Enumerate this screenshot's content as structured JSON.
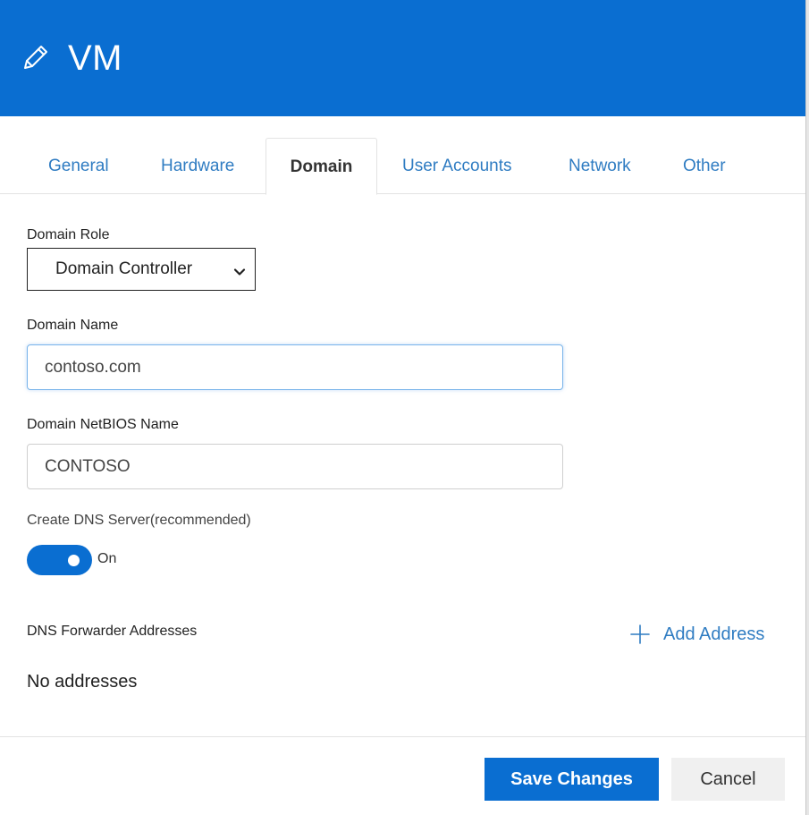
{
  "header": {
    "title": "VM",
    "icon": "pencil-icon",
    "background": "#0a6ed1"
  },
  "tabs": [
    {
      "label": "General",
      "active": false
    },
    {
      "label": "Hardware",
      "active": false
    },
    {
      "label": "Domain",
      "active": true
    },
    {
      "label": "User Accounts",
      "active": false
    },
    {
      "label": "Network",
      "active": false
    },
    {
      "label": "Other",
      "active": false
    }
  ],
  "form": {
    "domain_role": {
      "label": "Domain Role",
      "value": "Domain Controller"
    },
    "domain_name": {
      "label": "Domain Name",
      "value": "contoso.com"
    },
    "netbios_name": {
      "label": "Domain NetBIOS Name",
      "value": "CONTOSO"
    },
    "dns_server": {
      "label": "Create DNS Server(recommended)",
      "state": "On"
    },
    "dns_forwarders": {
      "label": "DNS Forwarder Addresses",
      "add_label": "Add Address",
      "empty_text": "No addresses"
    }
  },
  "footer": {
    "save_label": "Save Changes",
    "cancel_label": "Cancel"
  },
  "colors": {
    "accent": "#0a6ed1",
    "link": "#2f7cc2"
  }
}
